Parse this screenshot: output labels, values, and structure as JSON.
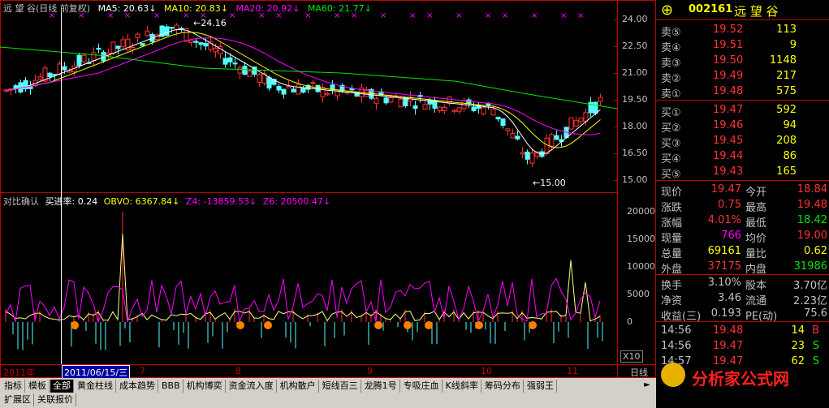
{
  "stock": {
    "code": "002161",
    "name": "远 望 谷"
  },
  "price_panel": {
    "title_name": "远 望 谷",
    "title_period": "(日线 前复权)",
    "ma5": "MA5: 20.63",
    "ma10": "MA10: 20.83",
    "ma20": "MA20: 20.92",
    "ma60": "MA60: 21.77",
    "high_marker": "24.16",
    "low_marker": "←15.00",
    "y_ticks": [
      "24.00",
      "22.50",
      "21.00",
      "19.50",
      "18.00",
      "16.50",
      "15.00"
    ]
  },
  "indicator_panel": {
    "name": "对比确认",
    "buy_rate": "买进率: 0.24",
    "obvo": "OBVO: 6367.84",
    "z4": "Z4: -13859.53",
    "z6": "Z6: 20500.47",
    "y_ticks": [
      "20000",
      "15000",
      "10000",
      "5000",
      "0"
    ],
    "multiplier": "X10"
  },
  "time_axis": {
    "year": "2011年",
    "cursor_date": "2011/06/15/三",
    "months": [
      "7",
      "8",
      "9",
      "10",
      "11"
    ],
    "period": "日线"
  },
  "order_book": {
    "asks": [
      {
        "label": "卖⑤",
        "price": "19.52",
        "vol": "113"
      },
      {
        "label": "卖④",
        "price": "19.51",
        "vol": "9"
      },
      {
        "label": "卖③",
        "price": "19.50",
        "vol": "1148"
      },
      {
        "label": "卖②",
        "price": "19.49",
        "vol": "217"
      },
      {
        "label": "卖①",
        "price": "19.48",
        "vol": "575"
      }
    ],
    "bids": [
      {
        "label": "买①",
        "price": "19.47",
        "vol": "592"
      },
      {
        "label": "买②",
        "price": "19.46",
        "vol": "94"
      },
      {
        "label": "买③",
        "price": "19.45",
        "vol": "208"
      },
      {
        "label": "买④",
        "price": "19.44",
        "vol": "86"
      },
      {
        "label": "买⑤",
        "price": "19.43",
        "vol": "165"
      }
    ]
  },
  "quote_stats": [
    {
      "l1": "现价",
      "v1": "19.47",
      "l2": "今开",
      "v2": "18.84"
    },
    {
      "l1": "涨跌",
      "v1": "0.75",
      "l2": "最高",
      "v2": "19.48"
    },
    {
      "l1": "涨幅",
      "v1": "4.01%",
      "l2": "最低",
      "v2": "18.42"
    },
    {
      "l1": "现量",
      "v1": "766",
      "l2": "均价",
      "v2": "19.00"
    },
    {
      "l1": "总量",
      "v1": "69161",
      "l2": "量比",
      "v2": "0.62"
    },
    {
      "l1": "外盘",
      "v1": "37175",
      "l2": "内盘",
      "v2": "31986"
    }
  ],
  "fundamentals": [
    {
      "l1": "换手",
      "v1": "3.10%",
      "l2": "股本",
      "v2": "3.70亿"
    },
    {
      "l1": "净资",
      "v1": "3.46",
      "l2": "流通",
      "v2": "2.23亿"
    },
    {
      "l1": "收益(三)",
      "v1": "0.193",
      "l2": "PE(动)",
      "v2": "75.6"
    }
  ],
  "ticks": [
    {
      "time": "14:56",
      "price": "19.48",
      "vol": "14",
      "side": "B"
    },
    {
      "time": "14:56",
      "price": "19.47",
      "vol": "23",
      "side": "S"
    },
    {
      "time": "14:57",
      "price": "19.47",
      "vol": "62",
      "side": "S"
    }
  ],
  "tabs": [
    "指标",
    "模板",
    "全部",
    "黄金柱线",
    "成本趋势",
    "BBB",
    "机构博奕",
    "资金流入度",
    "机构散户",
    "短线百三",
    "龙腾1号",
    "专吸庄血",
    "K线斜率",
    "筹码分布",
    "强弱王"
  ],
  "bottom_tabs": [
    "扩展区",
    "关联报价"
  ],
  "watermark": {
    "text": "分析家公式网",
    "url": "www.88gs.com"
  },
  "colors": {
    "up": "#ff3232",
    "down": "#54ffff",
    "ma5": "#ffffff",
    "ma10": "#ffff00",
    "ma20": "#ff00ff",
    "ma60": "#00e600",
    "border": "#c00000"
  }
}
